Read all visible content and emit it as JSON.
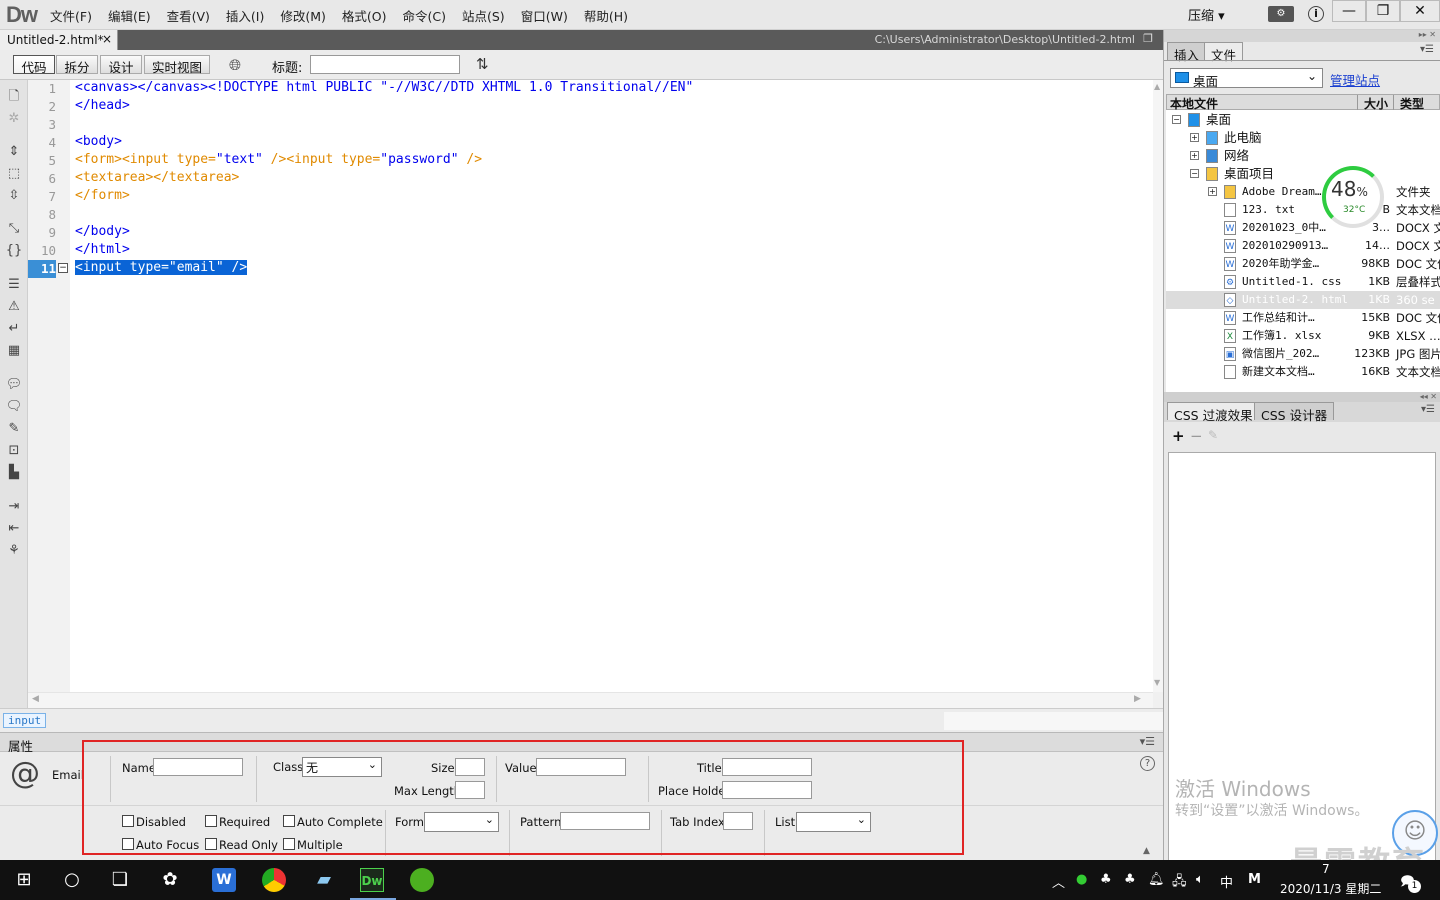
{
  "app": {
    "logo_d": "D",
    "logo_w": "w",
    "menus": [
      "文件(F)",
      "编辑(E)",
      "查看(V)",
      "插入(I)",
      "修改(M)",
      "格式(O)",
      "命令(C)",
      "站点(S)",
      "窗口(W)",
      "帮助(H)"
    ],
    "compress_label": "压缩 ▾",
    "window_buttons": {
      "minimize": "—",
      "restore": "❐",
      "close": "✕"
    }
  },
  "document": {
    "tab_label": "Untitled-2.html*",
    "tab_close": "×",
    "path": "C:\\Users\\Administrator\\Desktop\\Untitled-2.html"
  },
  "toolbar": {
    "views": [
      "代码",
      "拆分",
      "设计",
      "实时视图"
    ],
    "title_label": "标题:",
    "title_value": ""
  },
  "code": {
    "line_numbers": [
      "1",
      "2",
      "3",
      "4",
      "5",
      "6",
      "7",
      "8",
      "9",
      "10",
      "11"
    ],
    "lines": [
      [
        {
          "t": "<canvas></canvas><!DOCTYPE html PUBLIC \"-//W3C//DTD XHTML 1.0 Transitional//EN\"",
          "c": "tag"
        }
      ],
      [
        {
          "t": "</head>",
          "c": "tag"
        }
      ],
      [],
      [
        {
          "t": "<body>",
          "c": "tag"
        }
      ],
      [
        {
          "t": "<form><input type=",
          "c": "otag"
        },
        {
          "t": "\"text\"",
          "c": "val"
        },
        {
          "t": " /><input type=",
          "c": "otag"
        },
        {
          "t": "\"password\"",
          "c": "val"
        },
        {
          "t": " />",
          "c": "otag"
        }
      ],
      [
        {
          "t": "<textarea></textarea>",
          "c": "otag"
        }
      ],
      [
        {
          "t": "</form>",
          "c": "otag"
        }
      ],
      [],
      [
        {
          "t": "</body>",
          "c": "tag"
        }
      ],
      [
        {
          "t": "</html>",
          "c": "tag"
        }
      ],
      [
        {
          "t": "<input type=\"email\" />",
          "c": "sel"
        }
      ]
    ],
    "current_line": "11"
  },
  "status": {
    "tag_selector": "input"
  },
  "properties": {
    "panel_title": "属性",
    "element_icon": "@",
    "element_type": "Email",
    "name_label": "Name",
    "name_value": "",
    "class_label": "Class",
    "class_value": "无",
    "size_label": "Size",
    "maxlength_label": "Max Length",
    "value_label": "Value",
    "title_label": "Title",
    "placeholder_label": "Place Holder",
    "checkboxes": {
      "disabled": "Disabled",
      "required": "Required",
      "autocomplete": "Auto Complete",
      "autofocus": "Auto Focus",
      "readonly": "Read Only",
      "multiple": "Multiple"
    },
    "form_label": "Form",
    "pattern_label": "Pattern",
    "tabindex_label": "Tab Index",
    "list_label": "List",
    "help_icon": "?"
  },
  "files_panel": {
    "tabs": [
      "插入",
      "文件"
    ],
    "site": "桌面",
    "manage_link": "管理站点",
    "header_local": "本地文件",
    "header_size": "大小",
    "header_type": "类型",
    "tree": [
      {
        "name": "桌面",
        "size": "",
        "type": "",
        "level": 0,
        "icon": "desktop",
        "exp": "⊟"
      },
      {
        "name": "此电脑",
        "size": "",
        "type": "",
        "level": 1,
        "icon": "computer",
        "exp": "⊞"
      },
      {
        "name": "网络",
        "size": "",
        "type": "",
        "level": 1,
        "icon": "network",
        "exp": "⊞"
      },
      {
        "name": "桌面项目",
        "size": "",
        "type": "",
        "level": 1,
        "icon": "folder",
        "exp": "⊟"
      },
      {
        "name": "Adobe Dream…",
        "size": "",
        "type": "文件夹",
        "level": 2,
        "icon": "folder",
        "exp": "⊞"
      },
      {
        "name": "123. txt",
        "size": "B",
        "type": "文本文档",
        "level": 2,
        "icon": "txt",
        "exp": ""
      },
      {
        "name": "20201023_0中…",
        "size": "3…",
        "type": "DOCX 文",
        "level": 2,
        "icon": "docx",
        "exp": ""
      },
      {
        "name": "202010290913…",
        "size": "14…",
        "type": "DOCX 文",
        "level": 2,
        "icon": "docx",
        "exp": ""
      },
      {
        "name": "2020年助学金…",
        "size": "98KB",
        "type": "DOC 文件",
        "level": 2,
        "icon": "doc",
        "exp": ""
      },
      {
        "name": "Untitled-1. css",
        "size": "1KB",
        "type": "层叠样式",
        "level": 2,
        "icon": "css",
        "exp": ""
      },
      {
        "name": "Untitled-2. html",
        "size": "1KB",
        "type": "360 se",
        "level": 2,
        "icon": "html",
        "exp": "",
        "selected": true
      },
      {
        "name": "工作总结和计…",
        "size": "15KB",
        "type": "DOC 文件",
        "level": 2,
        "icon": "doc",
        "exp": ""
      },
      {
        "name": "工作簿1. xlsx",
        "size": "9KB",
        "type": "XLSX …",
        "level": 2,
        "icon": "xlsx",
        "exp": ""
      },
      {
        "name": "微信图片_202…",
        "size": "123KB",
        "type": "JPG 图片",
        "level": 2,
        "icon": "jpg",
        "exp": ""
      },
      {
        "name": "新建文本文档…",
        "size": "16KB",
        "type": "文本文档",
        "level": 2,
        "icon": "txt",
        "exp": ""
      }
    ],
    "gauge_percent": "48",
    "gauge_unit": "%",
    "gauge_temp": "32°C"
  },
  "css_panel": {
    "tabs": [
      "CSS 过渡效果",
      "CSS 设计器"
    ],
    "add": "+",
    "remove": "−"
  },
  "overlay": {
    "activate_title": "激活 Windows",
    "activate_sub": "转到“设置”以激活 Windows。",
    "watermark": "最需教育"
  },
  "taskbar": {
    "ime": "中",
    "ime2": "M",
    "time": "7",
    "date": "2020/11/3 星期二",
    "notify_count": "1"
  }
}
